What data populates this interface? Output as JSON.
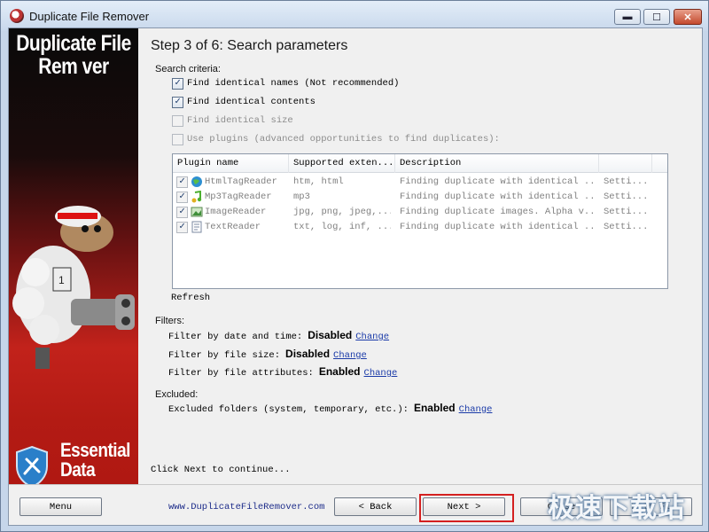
{
  "window": {
    "title": "Duplicate File Remover",
    "controls": {
      "minimize": "▬",
      "maximize": "☐",
      "close": "✕"
    }
  },
  "banner": {
    "product_line1": "Duplicate File",
    "product_line2": "Rem   ver",
    "company_line1": "Essential",
    "company_line2": "Data Tools"
  },
  "step": {
    "title": "Step 3 of 6: Search parameters"
  },
  "search_criteria": {
    "label": "Search criteria:",
    "options": [
      {
        "label": "Find identical names (Not recommended)",
        "checked": true,
        "enabled": true
      },
      {
        "label": "Find identical contents",
        "checked": true,
        "enabled": true
      },
      {
        "label": "Find identical size",
        "checked": false,
        "enabled": false
      },
      {
        "label": "Use plugins (advanced opportunities to find duplicates):",
        "checked": false,
        "enabled": false
      }
    ]
  },
  "plugins": {
    "columns": [
      "Plugin name",
      "Supported exten...",
      "Description",
      ""
    ],
    "rows": [
      {
        "name": "HtmlTagReader",
        "ext": "htm, html",
        "desc": "Finding duplicate with identical ...",
        "settings": "Setti...",
        "icon": "globe-icon"
      },
      {
        "name": "Mp3TagReader",
        "ext": "mp3",
        "desc": "Finding duplicate with identical ...",
        "settings": "Setti...",
        "icon": "music-note-icon"
      },
      {
        "name": "ImageReader",
        "ext": "jpg, png, jpeg,...",
        "desc": "Finding duplicate images. Alpha v...",
        "settings": "Setti...",
        "icon": "image-icon"
      },
      {
        "name": "TextReader",
        "ext": "txt, log, inf, ...",
        "desc": "Finding duplicate with identical ...",
        "settings": "Setti...",
        "icon": "document-icon"
      }
    ],
    "refresh": "Refresh"
  },
  "filters": {
    "label": "Filters:",
    "items": [
      {
        "text": "Filter by date and time:",
        "state": "Disabled",
        "action": "Change"
      },
      {
        "text": "Filter by file size:",
        "state": "Disabled",
        "action": "Change"
      },
      {
        "text": "Filter by file attributes:",
        "state": "Enabled",
        "action": "Change"
      }
    ]
  },
  "excluded": {
    "label": "Excluded:",
    "text": "Excluded folders (system, temporary, etc.):",
    "state": "Enabled",
    "action": "Change"
  },
  "footer_note": "Click Next to continue...",
  "buttons": {
    "menu": "Menu",
    "site": "www.DuplicateFileRemover.com",
    "back": "< Back",
    "next": "Next >",
    "close": "Close",
    "help": "Help F1"
  },
  "watermark": "极速下载站",
  "colors": {
    "banner_red": "#c2221b",
    "link": "#1a3aa8",
    "highlight": "#d42020"
  }
}
